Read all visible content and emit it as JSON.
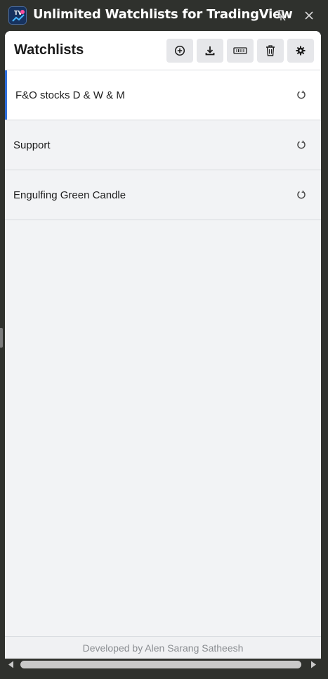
{
  "window": {
    "title": "Unlimited Watchlists for TradingView",
    "logo_text": "TV",
    "pin_icon": "unpin-icon",
    "close_icon": "close-icon"
  },
  "header": {
    "title": "Watchlists",
    "tools": [
      {
        "name": "add-watchlist-button",
        "icon": "plus-circle-icon"
      },
      {
        "name": "download-button",
        "icon": "download-icon"
      },
      {
        "name": "import-button",
        "icon": "ticket-icon"
      },
      {
        "name": "delete-button",
        "icon": "trash-icon"
      },
      {
        "name": "settings-button",
        "icon": "gear-icon"
      }
    ]
  },
  "watchlists": [
    {
      "label": "F&O stocks D & W & M",
      "active": true
    },
    {
      "label": "Support",
      "active": false
    },
    {
      "label": "Engulfing Green Candle",
      "active": false
    }
  ],
  "footer": {
    "text": "Developed by Alen Sarang Satheesh"
  },
  "colors": {
    "accent": "#2f6fdc",
    "frame": "#2f312d",
    "panel": "#f2f3f5"
  }
}
